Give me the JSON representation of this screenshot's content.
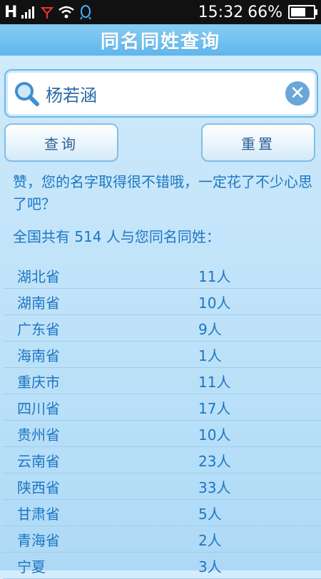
{
  "status_bar": {
    "network": "H",
    "time": "15:32",
    "battery": "66%",
    "battery_level": 0.66
  },
  "title": "同名同姓查询",
  "search": {
    "value": "杨若涵",
    "icon": "search-icon",
    "clear_icon": "clear-icon"
  },
  "buttons": {
    "query": "查询",
    "reset": "重置"
  },
  "message": "赞，您的名字取得很不错哦，一定花了不少心思了吧？",
  "summary": "全国共有 514 人与您同名同姓：",
  "results": [
    {
      "province": "湖北省",
      "count": "11人"
    },
    {
      "province": "湖南省",
      "count": "10人"
    },
    {
      "province": "广东省",
      "count": "9人"
    },
    {
      "province": "海南省",
      "count": "1人"
    },
    {
      "province": "重庆市",
      "count": "11人"
    },
    {
      "province": "四川省",
      "count": "17人"
    },
    {
      "province": "贵州省",
      "count": "10人"
    },
    {
      "province": "云南省",
      "count": "23人"
    },
    {
      "province": "陕西省",
      "count": "33人"
    },
    {
      "province": "甘肃省",
      "count": "5人"
    },
    {
      "province": "青海省",
      "count": "2人"
    },
    {
      "province": "宁夏",
      "count": "3人"
    }
  ],
  "colors": {
    "title_bar": "#5fb7ee",
    "text": "#1e76c2",
    "background": "#c7e6fa"
  }
}
